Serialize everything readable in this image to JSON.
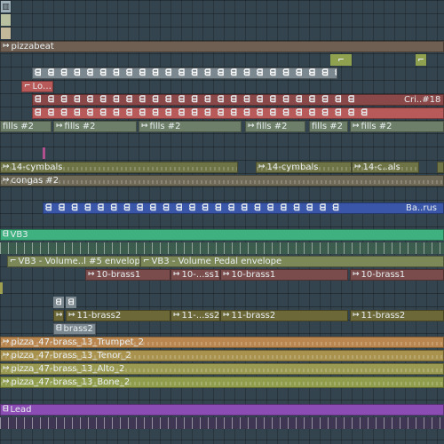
{
  "icons": {
    "audio_arrow": "↦",
    "pattern_block": "ᗺ",
    "automation_curve": "⌐"
  },
  "clips": {
    "pizzabeat": "pizzabeat",
    "lo": "Lo…",
    "cri18": "Cri..#18",
    "fills2": "fills #2",
    "cymbals": "14-cymbals",
    "cymbals_short": "14-c..als",
    "congas2": "congas #2",
    "barus": "Ba..rus",
    "vb3": "VB3",
    "vb3_env1": "VB3 - Volume..l #5 envelope",
    "vb3_env2": "VB3 - Volume Pedal envelope",
    "brass1": "10-brass1",
    "brass1_short": "10-...ss1",
    "brass2": "11-brass2",
    "brass2_short": "11-...ss2",
    "brass2_pat": "brass2",
    "trumpet": "pizza_47-brass_13_Trumpet_2",
    "tenor": "pizza_47-brass_13_Tenor_2",
    "alto": "pizza_47-brass_13_Alto_2",
    "bone": "pizza_47-brass_13_Bone_2",
    "lead": "Lead"
  },
  "colors": {
    "background": "#34444e",
    "pizzabeat": "#6e5f52",
    "red_dark": "#8a4848",
    "red": "#b85a5a",
    "fills": "#6d7f69",
    "olive": "#6f7446",
    "congas": "#6f6a58",
    "blue": "#3a56a8",
    "green": "#3fb07f",
    "envelope": "#7c8858",
    "brass_red": "#7a4c4c",
    "brass_olive": "#6c6838",
    "pizza_orange": "#b9864f",
    "pizza_gold": "#a8924e",
    "pizza_olive": "#9a9a52",
    "pizza_green": "#8f9d4c",
    "lead": "#8b4db4"
  }
}
